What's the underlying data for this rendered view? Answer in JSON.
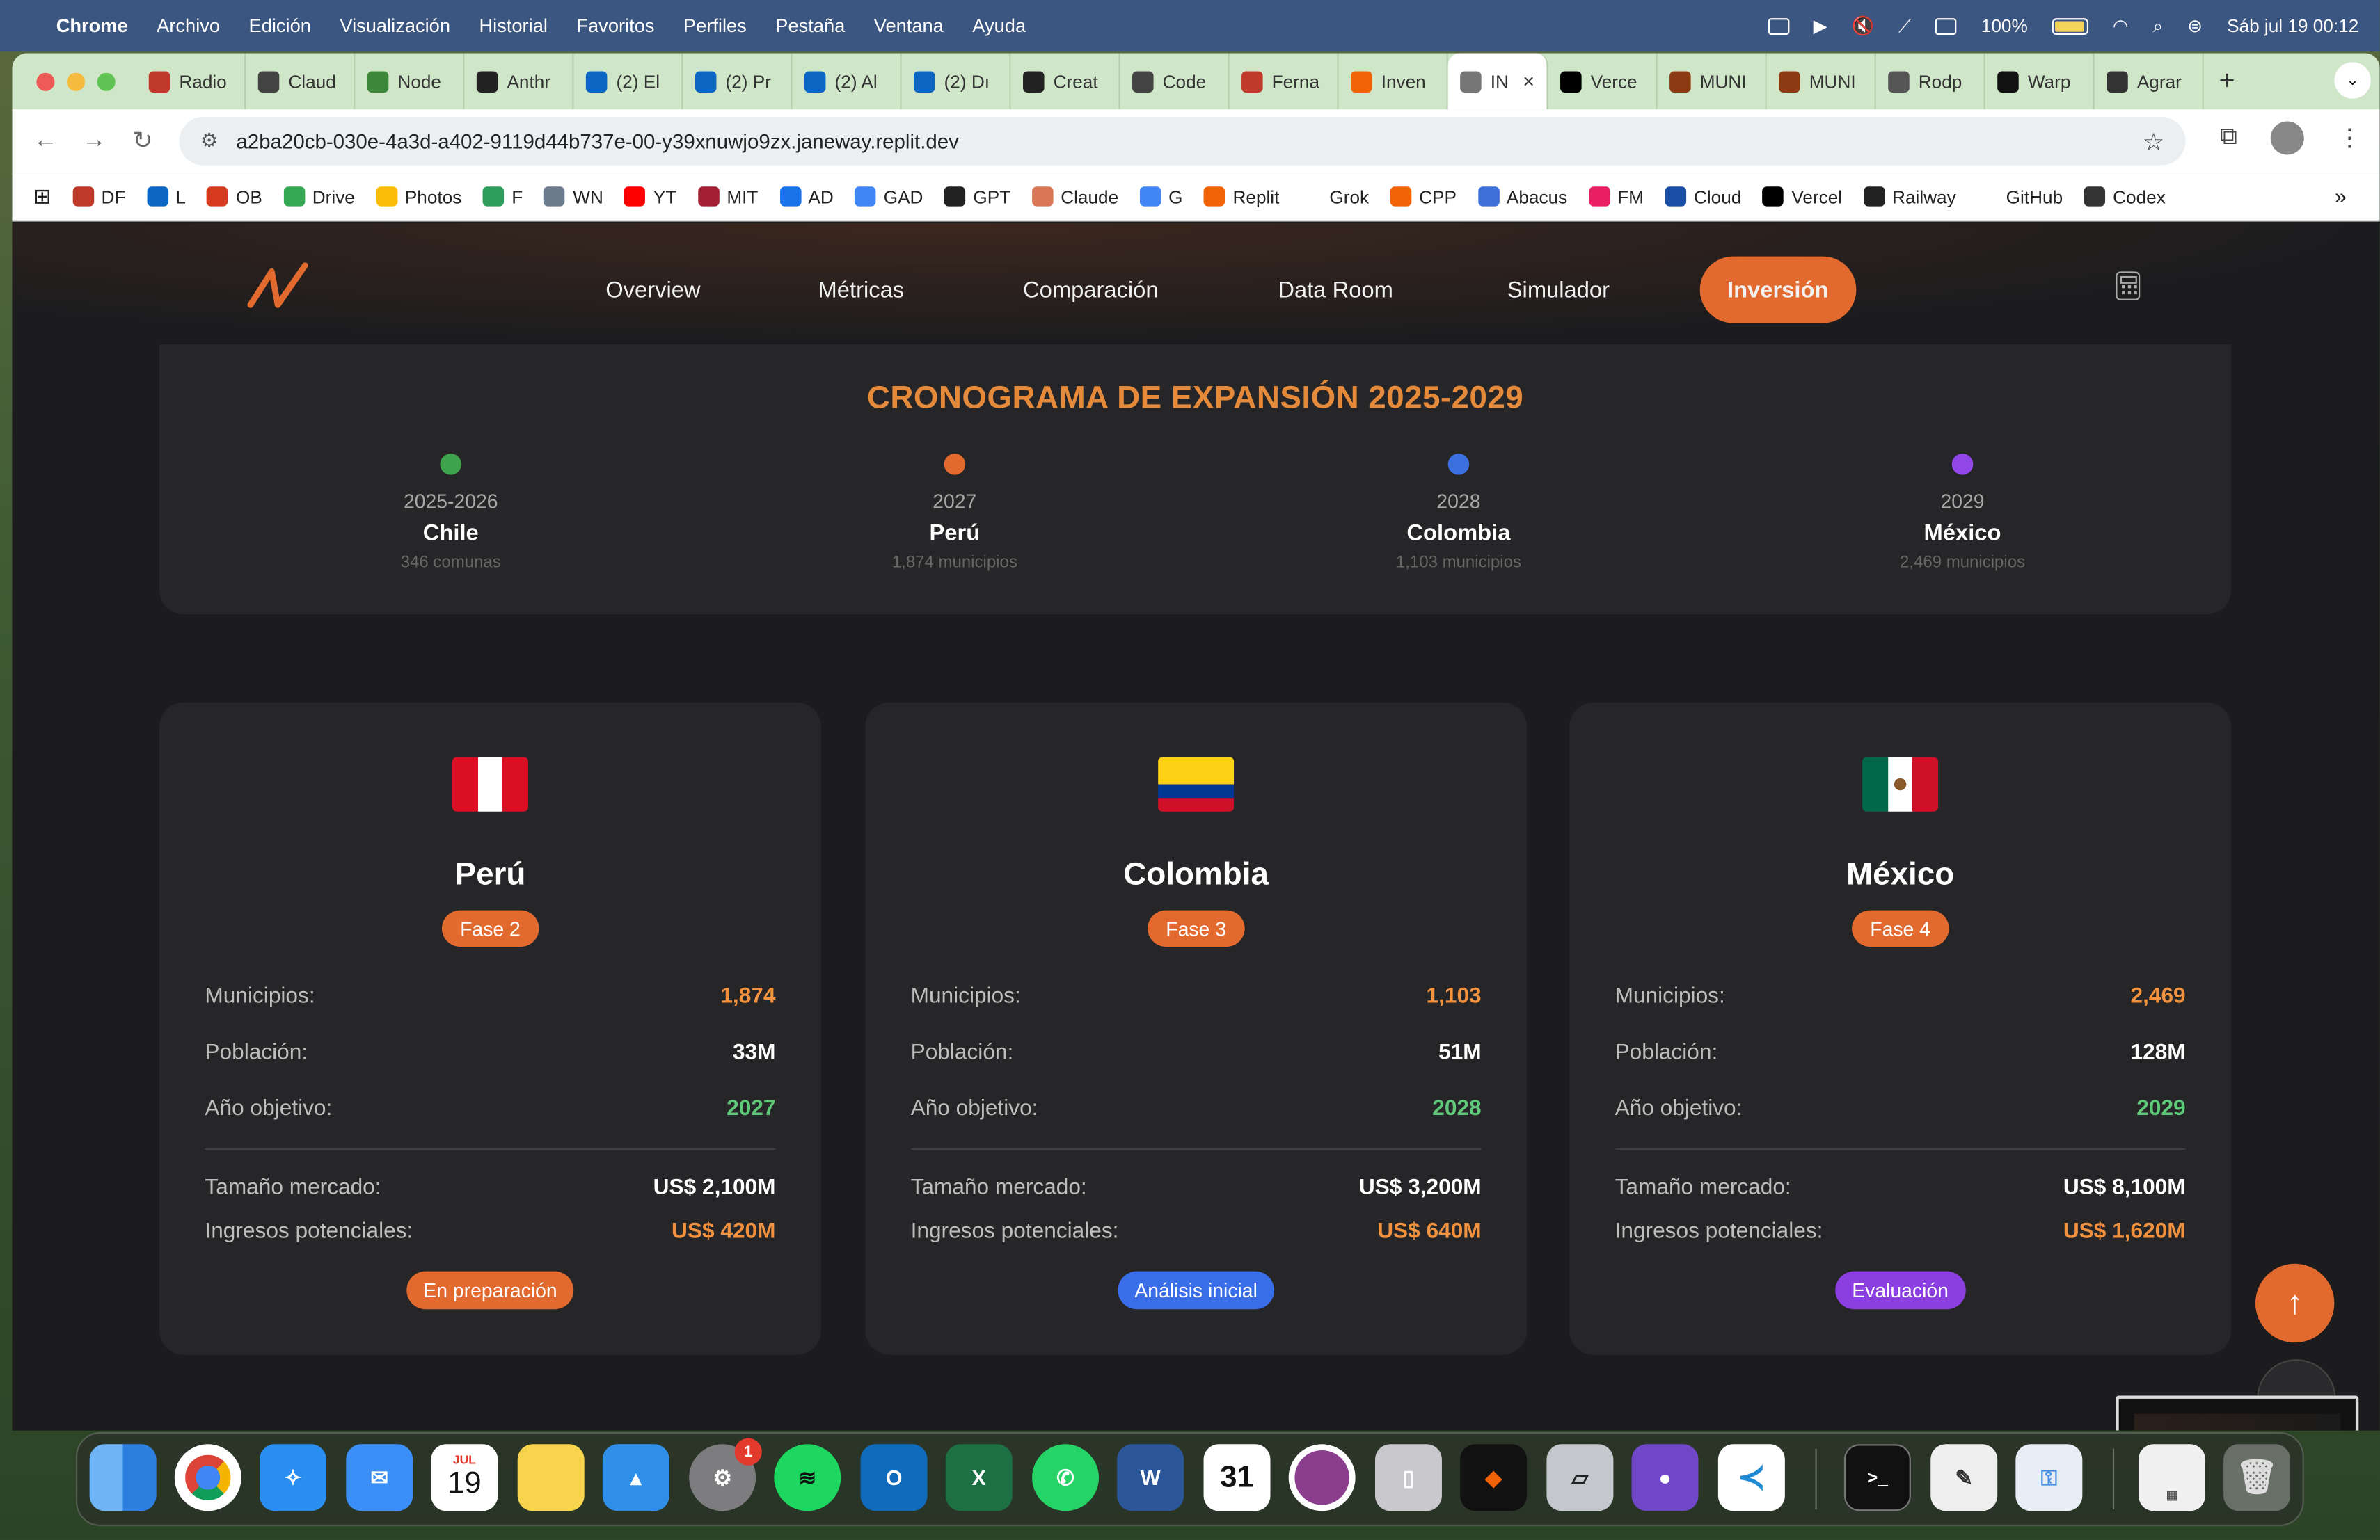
{
  "menubar": {
    "app": "Chrome",
    "items": [
      "Archivo",
      "Edición",
      "Visualización",
      "Historial",
      "Favoritos",
      "Perfiles",
      "Pestaña",
      "Ventana",
      "Ayuda"
    ],
    "battery": "100%",
    "datetime": "Sáb jul 19  00:12"
  },
  "tabs": [
    {
      "label": "Radio",
      "icon": "df-icon",
      "color": "#c0392b"
    },
    {
      "label": "Claud",
      "icon": "anthropic-icon",
      "color": "#444"
    },
    {
      "label": "Node",
      "icon": "node-icon",
      "color": "#3c873a"
    },
    {
      "label": "Anthr",
      "icon": "anthropic-icon",
      "color": "#222"
    },
    {
      "label": "(2) El",
      "icon": "linkedin-icon",
      "color": "#0a66c2"
    },
    {
      "label": "(2) Pr",
      "icon": "linkedin-icon",
      "color": "#0a66c2"
    },
    {
      "label": "(2) Al",
      "icon": "linkedin-icon",
      "color": "#0a66c2"
    },
    {
      "label": "(2) Dı",
      "icon": "linkedin-icon",
      "color": "#0a66c2"
    },
    {
      "label": "Creat",
      "icon": "veo-icon",
      "color": "#222"
    },
    {
      "label": "Code",
      "icon": "codex-icon",
      "color": "#444"
    },
    {
      "label": "Ferna",
      "icon": "df-icon",
      "color": "#c0392b"
    },
    {
      "label": "Inven",
      "icon": "replit-icon",
      "color": "#f26207"
    },
    {
      "label": "IN",
      "icon": "globe-icon",
      "color": "#777",
      "active": true
    },
    {
      "label": "Verce",
      "icon": "vercel-icon",
      "color": "#000"
    },
    {
      "label": "MUNI",
      "icon": "muni-icon",
      "color": "#8a3b12"
    },
    {
      "label": "MUNI",
      "icon": "muni-icon",
      "color": "#8a3b12"
    },
    {
      "label": "Rodp",
      "icon": "github-icon",
      "color": "#555"
    },
    {
      "label": "Warp",
      "icon": "warp-icon",
      "color": "#111"
    },
    {
      "label": "Agrar",
      "icon": "openai-icon",
      "color": "#333"
    }
  ],
  "url": "a2ba20cb-030e-4a3d-a402-9119d44b737e-00-y39xnuwjo9zx.janeway.replit.dev",
  "bookmarks": [
    {
      "label": "DF",
      "color": "#c0392b"
    },
    {
      "label": "L",
      "color": "#0a66c2"
    },
    {
      "label": "OB",
      "color": "#d63b1f"
    },
    {
      "label": "Drive",
      "color": "#34a853"
    },
    {
      "label": "Photos",
      "color": "#fbbc05"
    },
    {
      "label": "F",
      "color": "#2e9d5b"
    },
    {
      "label": "WN",
      "color": "#6b7b8c"
    },
    {
      "label": "YT",
      "color": "#ff0000"
    },
    {
      "label": "MIT",
      "color": "#a31f34"
    },
    {
      "label": "AD",
      "color": "#1a73e8"
    },
    {
      "label": "GAD",
      "color": "#4285f4"
    },
    {
      "label": "GPT",
      "color": "#222"
    },
    {
      "label": "Claude",
      "color": "#d97757"
    },
    {
      "label": "G",
      "color": "#4285f4"
    },
    {
      "label": "Replit",
      "color": "#f26207"
    },
    {
      "label": "Grok",
      "color": "#fff"
    },
    {
      "label": "CPP",
      "color": "#f26207"
    },
    {
      "label": "Abacus",
      "color": "#3d6fd8"
    },
    {
      "label": "FM",
      "color": "#e91e63"
    },
    {
      "label": "Cloud",
      "color": "#1a4fa8"
    },
    {
      "label": "Vercel",
      "color": "#000"
    },
    {
      "label": "Railway",
      "color": "#222"
    },
    {
      "label": "GitHub",
      "color": "#fff"
    },
    {
      "label": "Codex",
      "color": "#333"
    }
  ],
  "site": {
    "nav": [
      "Overview",
      "Métricas",
      "Comparación",
      "Data Room",
      "Simulador",
      "Inversión"
    ],
    "active_nav": "Inversión"
  },
  "timeline": {
    "title": "CRONOGRAMA DE EXPANSIÓN 2025-2029",
    "items": [
      {
        "year": "2025-2026",
        "country": "Chile",
        "sub": "346 comunas",
        "color": "#3fa34d"
      },
      {
        "year": "2027",
        "country": "Perú",
        "sub": "1,874 municipios",
        "color": "#e36a2e"
      },
      {
        "year": "2028",
        "country": "Colombia",
        "sub": "1,103 municipios",
        "color": "#3b6fe0"
      },
      {
        "year": "2029",
        "country": "México",
        "sub": "2,469 municipios",
        "color": "#9146e8"
      }
    ]
  },
  "labels": {
    "municipios": "Municipios:",
    "poblacion": "Población:",
    "anio": "Año objetivo:",
    "mercado": "Tamaño mercado:",
    "ingresos": "Ingresos potenciales:"
  },
  "cards": [
    {
      "name": "Perú",
      "phase": "Fase 2",
      "municipios": "1,874",
      "poblacion": "33M",
      "anio": "2027",
      "mercado": "US$ 2,100M",
      "ingresos": "US$ 420M",
      "status": "En preparación",
      "status_color": "#e36a2e"
    },
    {
      "name": "Colombia",
      "phase": "Fase 3",
      "municipios": "1,103",
      "poblacion": "51M",
      "anio": "2028",
      "mercado": "US$ 3,200M",
      "ingresos": "US$ 640M",
      "status": "Análisis inicial",
      "status_color": "#3a6ee8"
    },
    {
      "name": "México",
      "phase": "Fase 4",
      "municipios": "2,469",
      "poblacion": "128M",
      "anio": "2029",
      "mercado": "US$ 8,100M",
      "ingresos": "US$ 1,620M",
      "status": "Evaluación",
      "status_color": "#8b3fe0"
    }
  ],
  "dock": {
    "calendar_month": "JUL",
    "calendar_day": "19",
    "settings_badge": "1",
    "calendar2_day": "31"
  }
}
